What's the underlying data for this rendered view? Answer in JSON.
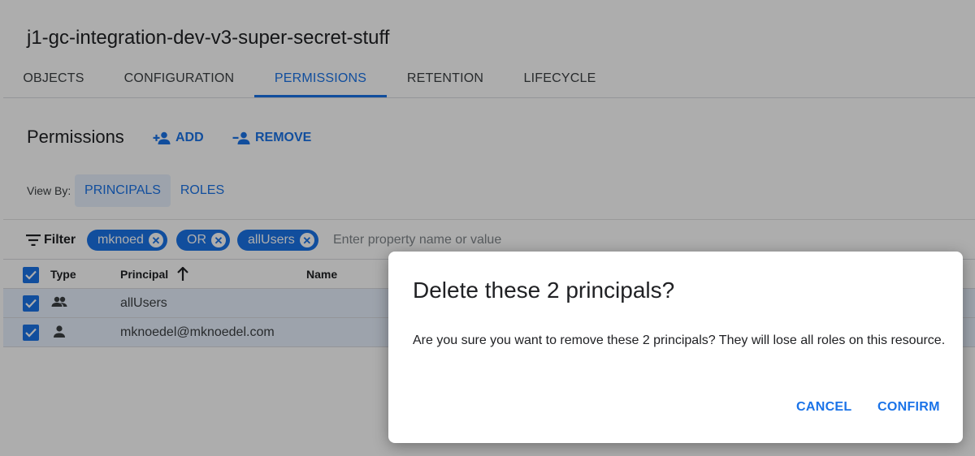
{
  "bucket": {
    "name": "j1-gc-integration-dev-v3-super-secret-stuff"
  },
  "tabs": [
    {
      "label": "OBJECTS",
      "active": false
    },
    {
      "label": "CONFIGURATION",
      "active": false
    },
    {
      "label": "PERMISSIONS",
      "active": true
    },
    {
      "label": "RETENTION",
      "active": false
    },
    {
      "label": "LIFECYCLE",
      "active": false
    }
  ],
  "permissions": {
    "title": "Permissions",
    "add_label": "ADD",
    "add_icon": "person-add-icon",
    "remove_label": "REMOVE",
    "remove_icon": "person-remove-icon"
  },
  "view_by": {
    "label": "View By:",
    "options": [
      {
        "label": "PRINCIPALS",
        "selected": true
      },
      {
        "label": "ROLES",
        "selected": false
      }
    ]
  },
  "filter": {
    "label": "Filter",
    "icon": "filter-icon",
    "chips": [
      "mknoed",
      "OR",
      "allUsers"
    ],
    "placeholder": "Enter property name or value"
  },
  "table": {
    "columns": [
      "Type",
      "Principal",
      "Name"
    ],
    "sort_column": "Principal",
    "sort_direction": "ascending",
    "header_checked": true,
    "rows": [
      {
        "type_icon": "group-icon",
        "principal": "allUsers",
        "checked": true
      },
      {
        "type_icon": "person-icon",
        "principal": "mknoedel@mknoedel.com",
        "checked": true
      }
    ]
  },
  "dialog": {
    "title": "Delete these 2 principals?",
    "body": "Are you sure you want to remove these 2 principals? They will lose all roles on this resource.",
    "cancel_label": "CANCEL",
    "confirm_label": "CONFIRM"
  },
  "colors": {
    "accent": "#1a73e8",
    "selected_row": "#e8f0fe",
    "scrim": "rgba(0,0,0,0.32)"
  }
}
